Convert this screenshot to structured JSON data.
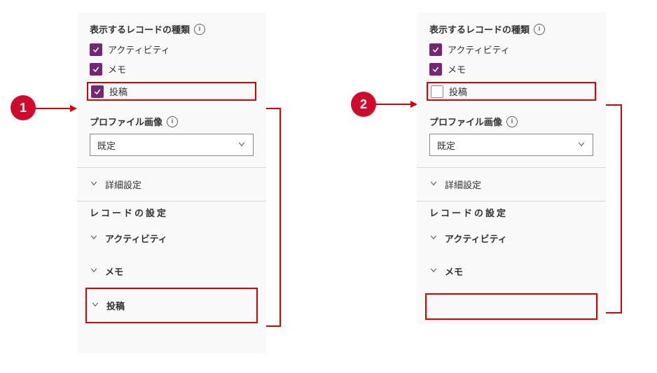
{
  "badges": {
    "one": "1",
    "two": "2"
  },
  "panel1": {
    "records_title": "表示するレコードの種類",
    "chk_activity": "アクティビティ",
    "chk_memo": "メモ",
    "chk_post": "投稿",
    "profile_img_title": "プロファイル画像",
    "profile_select_value": "既定",
    "advanced": "詳細設定",
    "records_settings": "レコードの設定",
    "exp_activity": "アクティビティ",
    "exp_memo": "メモ",
    "exp_post": "投稿"
  },
  "panel2": {
    "records_title": "表示するレコードの種類",
    "chk_activity": "アクティビティ",
    "chk_memo": "メモ",
    "chk_post": "投稿",
    "profile_img_title": "プロファイル画像",
    "profile_select_value": "既定",
    "advanced": "詳細設定",
    "records_settings": "レコードの設定",
    "exp_activity": "アクティビティ",
    "exp_memo": "メモ"
  }
}
